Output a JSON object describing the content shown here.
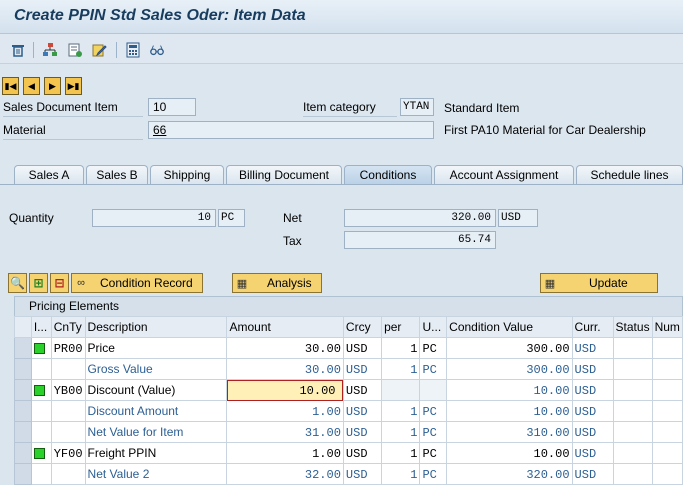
{
  "title": "Create PPIN Std Sales Oder: Item Data",
  "toolbar": {
    "icons": [
      "trash-icon",
      "org-icon",
      "notes-icon",
      "edit-icon",
      "calculator-icon",
      "glasses-icon"
    ]
  },
  "header": {
    "sales_doc_item_label": "Sales Document Item",
    "sales_doc_item_value": "10",
    "item_category_label": "Item category",
    "item_category_value": "YTAN",
    "item_category_desc": "Standard Item",
    "material_label": "Material",
    "material_value": "66",
    "material_desc": "First PA10 Material for Car Dealership"
  },
  "tabs": [
    "Sales A",
    "Sales B",
    "Shipping",
    "Billing Document",
    "Conditions",
    "Account Assignment",
    "Schedule lines"
  ],
  "active_tab": "Conditions",
  "conditions": {
    "quantity_label": "Quantity",
    "quantity_value": "10",
    "quantity_unit": "PC",
    "net_label": "Net",
    "net_value": "320.00",
    "net_currency": "USD",
    "tax_label": "Tax",
    "tax_value": "65.74"
  },
  "buttons": {
    "condition_record": "Condition Record",
    "analysis": "Analysis",
    "update": "Update"
  },
  "pricing": {
    "section_label": "Pricing Elements",
    "columns": [
      "I...",
      "CnTy",
      "Description",
      "Amount",
      "Crcy",
      "per",
      "U...",
      "Condition Value",
      "Curr.",
      "Status",
      "Num"
    ],
    "rows": [
      {
        "status": true,
        "cnty": "PR00",
        "desc": "Price",
        "amount": "30.00",
        "crcy": "USD",
        "per": "1",
        "uom": "PC",
        "value": "300.00",
        "curr": "USD",
        "sub": false
      },
      {
        "status": false,
        "cnty": "",
        "desc": "Gross Value",
        "amount": "30.00",
        "crcy": "USD",
        "per": "1",
        "uom": "PC",
        "value": "300.00",
        "curr": "USD",
        "sub": true
      },
      {
        "status": true,
        "cnty": "YB00",
        "desc": "Discount (Value)",
        "amount": "10.00",
        "crcy": "USD",
        "per": "",
        "uom": "",
        "value": "10.00",
        "curr": "USD",
        "sub": false
      },
      {
        "status": false,
        "cnty": "",
        "desc": "Discount Amount",
        "amount": "1.00",
        "crcy": "USD",
        "per": "1",
        "uom": "PC",
        "value": "10.00",
        "curr": "USD",
        "sub": true
      },
      {
        "status": false,
        "cnty": "",
        "desc": "Net Value for Item",
        "amount": "31.00",
        "crcy": "USD",
        "per": "1",
        "uom": "PC",
        "value": "310.00",
        "curr": "USD",
        "sub": true
      },
      {
        "status": true,
        "cnty": "YF00",
        "desc": "Freight PPIN",
        "amount": "1.00",
        "crcy": "USD",
        "per": "1",
        "uom": "PC",
        "value": "10.00",
        "curr": "USD",
        "sub": false
      },
      {
        "status": false,
        "cnty": "",
        "desc": "Net Value 2",
        "amount": "32.00",
        "crcy": "USD",
        "per": "1",
        "uom": "PC",
        "value": "320.00",
        "curr": "USD",
        "sub": true
      }
    ]
  }
}
